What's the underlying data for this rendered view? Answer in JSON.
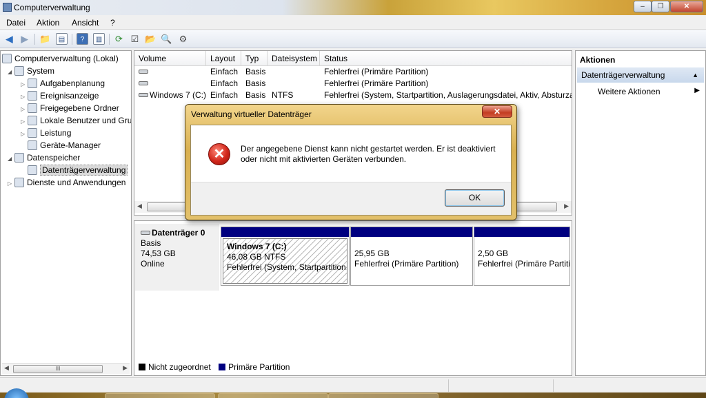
{
  "window": {
    "title": "Computerverwaltung",
    "minimize": "–",
    "maximize": "❐",
    "close": "✕"
  },
  "menu": [
    "Datei",
    "Aktion",
    "Ansicht",
    "?"
  ],
  "tree": {
    "items": [
      {
        "label": "Computerverwaltung (Lokal)",
        "icon": "computer-management-icon"
      },
      {
        "label": "System",
        "icon": "system-tools-icon"
      },
      {
        "label": "Aufgabenplanung",
        "icon": "task-scheduler-icon"
      },
      {
        "label": "Ereignisanzeige",
        "icon": "event-viewer-icon"
      },
      {
        "label": "Freigegebene Ordner",
        "icon": "shared-folders-icon"
      },
      {
        "label": "Lokale Benutzer und Gruppen",
        "icon": "users-icon"
      },
      {
        "label": "Leistung",
        "icon": "performance-icon"
      },
      {
        "label": "Geräte-Manager",
        "icon": "device-manager-icon"
      },
      {
        "label": "Datenspeicher",
        "icon": "storage-icon"
      },
      {
        "label": "Datenträgerverwaltung",
        "icon": "disk-management-icon"
      },
      {
        "label": "Dienste und Anwendungen",
        "icon": "services-icon"
      }
    ],
    "scroll_grip": "III"
  },
  "volumes": {
    "columns": [
      "Volume",
      "Layout",
      "Typ",
      "Dateisystem",
      "Status"
    ],
    "rows": [
      {
        "volume": "",
        "layout": "Einfach",
        "typ": "Basis",
        "fs": "",
        "status": "Fehlerfrei (Primäre Partition)"
      },
      {
        "volume": "",
        "layout": "Einfach",
        "typ": "Basis",
        "fs": "",
        "status": "Fehlerfrei (Primäre Partition)"
      },
      {
        "volume": "Windows 7 (C:)",
        "layout": "Einfach",
        "typ": "Basis",
        "fs": "NTFS",
        "status": "Fehlerfrei (System, Startpartition, Auslagerungsdatei, Aktiv, Absturzabbild)"
      }
    ]
  },
  "disk": {
    "name": "Datenträger 0",
    "type": "Basis",
    "size": "74,53 GB",
    "state": "Online",
    "partitions": [
      {
        "title": "Windows 7  (C:)",
        "size": "46,08 GB NTFS",
        "status": "Fehlerfrei (System, Startpartition,"
      },
      {
        "title": "",
        "size": "25,95 GB",
        "status": "Fehlerfrei (Primäre Partition)"
      },
      {
        "title": "",
        "size": "2,50 GB",
        "status": "Fehlerfrei (Primäre Partition)"
      }
    ],
    "legend": [
      {
        "label": "Nicht zugeordnet",
        "color": "#000000"
      },
      {
        "label": "Primäre Partition",
        "color": "#000080"
      }
    ]
  },
  "actions": {
    "title": "Aktionen",
    "section": "Datenträgerverwaltung",
    "item": "Weitere Aktionen"
  },
  "dialog": {
    "title": "Verwaltung virtueller Datenträger",
    "close": "✕",
    "message": "Der angegebene Dienst kann nicht gestartet werden. Er ist deaktiviert oder nicht mit aktivierten Geräten verbunden.",
    "ok": "OK",
    "icon": "error-icon"
  }
}
